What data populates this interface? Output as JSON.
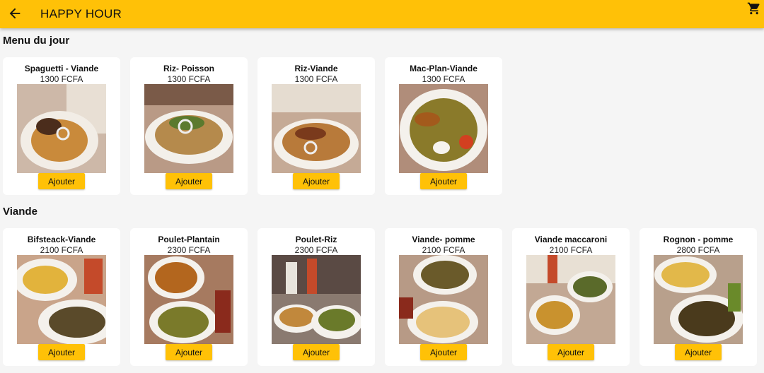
{
  "app": {
    "title": "HAPPY HOUR",
    "back_icon": "arrow-back-icon",
    "cart_icon": "shopping-cart-icon",
    "accent_color": "#ffc107"
  },
  "sections": [
    {
      "title": "Menu du jour",
      "items": [
        {
          "name": "Spaguetti - Viande",
          "price": "1300 FCFA",
          "button": "Ajouter"
        },
        {
          "name": "Riz- Poisson",
          "price": "1300 FCFA",
          "button": "Ajouter"
        },
        {
          "name": "Riz-Viande",
          "price": "1300 FCFA",
          "button": "Ajouter"
        },
        {
          "name": "Mac-Plan-Viande",
          "price": "1300 FCFA",
          "button": "Ajouter"
        }
      ]
    },
    {
      "title": "Viande",
      "items": [
        {
          "name": "Bifsteack-Viande",
          "price": "2100 FCFA",
          "button": "Ajouter"
        },
        {
          "name": "Poulet-Plantain",
          "price": "2300 FCFA",
          "button": "Ajouter"
        },
        {
          "name": "Poulet-Riz",
          "price": "2300 FCFA",
          "button": "Ajouter"
        },
        {
          "name": "Viande- pomme",
          "price": "2100 FCFA",
          "button": "Ajouter"
        },
        {
          "name": "Viande maccaroni",
          "price": "2100 FCFA",
          "button": "Ajouter"
        },
        {
          "name": "Rognon - pomme",
          "price": "2800 FCFA",
          "button": "Ajouter"
        }
      ]
    }
  ]
}
